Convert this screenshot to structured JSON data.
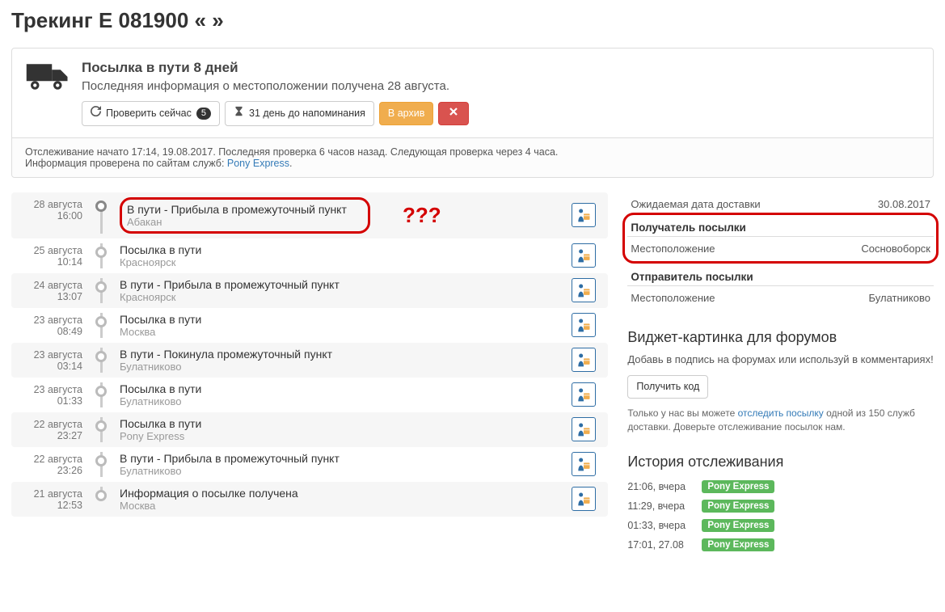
{
  "page_title": "Трекинг E            081900      «                »",
  "status": {
    "title": "Посылка в пути 8 дней",
    "subtitle": "Последняя информация о местоположении получена 28 августа.",
    "check_now": "Проверить сейчас",
    "check_badge": "5",
    "remind": "31 день до напоминания",
    "archive": "В архив",
    "footer_line1_a": "Отслеживание начато 17:14, 19.08.2017. Последняя проверка 6 часов назад. Следующая проверка через 4 часа.",
    "footer_line2_a": "Информация проверена по сайтам служб: ",
    "footer_service": "Pony Express",
    "footer_dot": "."
  },
  "annotations": {
    "question": "???",
    "exclaim": "!!!"
  },
  "timeline": [
    {
      "date": "28 августа",
      "time": "16:00",
      "status": "В пути - Прибыла в промежуточный пункт",
      "loc": "Абакан",
      "alt": true,
      "first": true,
      "highlight": true
    },
    {
      "date": "25 августа",
      "time": "10:14",
      "status": "Посылка в пути",
      "loc": "Красноярск",
      "alt": false
    },
    {
      "date": "24 августа",
      "time": "13:07",
      "status": "В пути - Прибыла в промежуточный пункт",
      "loc": "Красноярск",
      "alt": true
    },
    {
      "date": "23 августа",
      "time": "08:49",
      "status": "Посылка в пути",
      "loc": "Москва",
      "alt": false
    },
    {
      "date": "23 августа",
      "time": "03:14",
      "status": "В пути - Покинула промежуточный пункт",
      "loc": "Булатниково",
      "alt": true
    },
    {
      "date": "23 августа",
      "time": "01:33",
      "status": "Посылка в пути",
      "loc": "Булатниково",
      "alt": false
    },
    {
      "date": "22 августа",
      "time": "23:27",
      "status": "Посылка в пути",
      "loc": "Pony Express",
      "alt": true
    },
    {
      "date": "22 августа",
      "time": "23:26",
      "status": "В пути - Прибыла в промежуточный пункт",
      "loc": "Булатниково",
      "alt": false
    },
    {
      "date": "21 августа",
      "time": "12:53",
      "status": "Информация о посылке получена",
      "loc": "Москва",
      "alt": true,
      "last": true
    }
  ],
  "info": {
    "expected_label": "Ожидаемая дата доставки",
    "expected_value": "30.08.2017",
    "recipient_header": "Получатель посылки",
    "recipient_loc_label": "Местоположение",
    "recipient_loc_value": "Сосновоборск",
    "sender_header": "Отправитель посылки",
    "sender_loc_label": "Местоположение",
    "sender_loc_value": "Булатниково"
  },
  "widget": {
    "title": "Виджет-картинка для форумов",
    "desc": "Добавь в подпись на форумах или используй в комментариях!",
    "get_code": "Получить код",
    "note_a": "Только у нас вы можете ",
    "note_link": "отследить посылку",
    "note_b": " одной из 150 служб доставки. Доверьте отслеживание посылок нам."
  },
  "history": {
    "title": "История отслеживания",
    "items": [
      {
        "time": "21:06, вчера",
        "service": "Pony Express"
      },
      {
        "time": "11:29, вчера",
        "service": "Pony Express"
      },
      {
        "time": "01:33, вчера",
        "service": "Pony Express"
      },
      {
        "time": "17:01, 27.08",
        "service": "Pony Express"
      }
    ]
  }
}
